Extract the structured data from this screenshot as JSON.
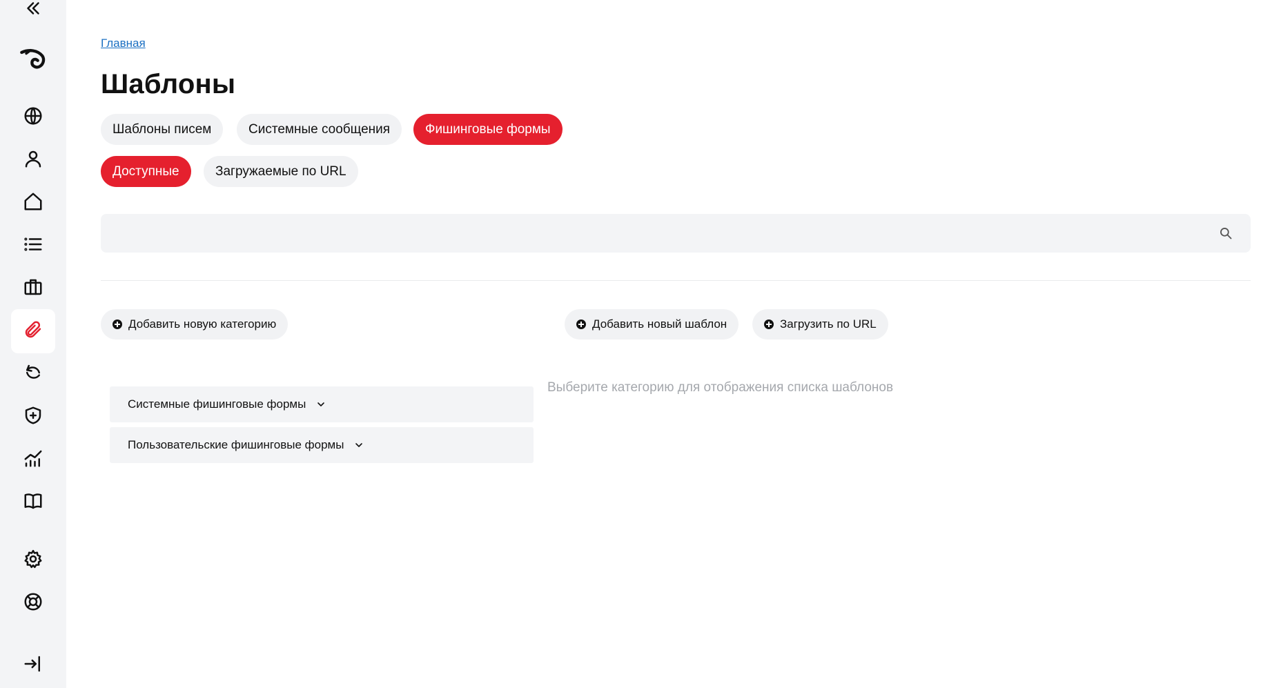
{
  "sidebar": {
    "items": [
      {
        "icon": "collapse-icon"
      },
      {
        "icon": "logo-icon"
      },
      {
        "icon": "globe-icon"
      },
      {
        "icon": "user-icon"
      },
      {
        "icon": "home-icon"
      },
      {
        "icon": "list-icon"
      },
      {
        "icon": "briefcase-icon"
      },
      {
        "icon": "paperclip-icon",
        "active": true
      },
      {
        "icon": "refresh-icon"
      },
      {
        "icon": "shield-plus-icon"
      },
      {
        "icon": "analytics-icon"
      },
      {
        "icon": "book-icon"
      },
      {
        "icon": "gear-icon"
      },
      {
        "icon": "lifebuoy-icon"
      },
      {
        "icon": "logout-icon"
      }
    ],
    "accent_color": "#e3202f"
  },
  "breadcrumb": {
    "home": "Главная"
  },
  "page": {
    "title": "Шаблоны"
  },
  "tabs": [
    {
      "label": "Шаблоны писем",
      "active": false
    },
    {
      "label": "Системные сообщения",
      "active": false
    },
    {
      "label": "Фишинговые формы",
      "active": true
    }
  ],
  "subtabs": [
    {
      "label": "Доступные",
      "active": true
    },
    {
      "label": "Загружаемые по URL",
      "active": false
    }
  ],
  "search": {
    "value": "",
    "placeholder": ""
  },
  "actions": {
    "add_category": "Добавить новую категорию",
    "add_template": "Добавить новый шаблон",
    "load_url": "Загрузить по URL"
  },
  "categories": [
    {
      "label": "Системные фишинговые формы"
    },
    {
      "label": "Пользовательские фишинговые формы"
    }
  ],
  "hint": "Выберите категорию для отображения списка шаблонов",
  "colors": {
    "accent": "#e5202e",
    "pill_bg": "#f1f2f4",
    "link": "#1a6fc2"
  }
}
